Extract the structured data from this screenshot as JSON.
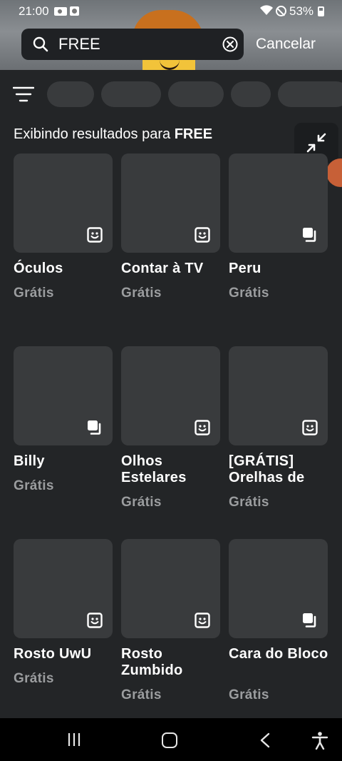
{
  "status": {
    "time": "21:00",
    "battery": "53%"
  },
  "search": {
    "value": "FREE",
    "cancel_label": "Cancelar"
  },
  "results": {
    "prefix": "Exibindo resultados para ",
    "query": "FREE"
  },
  "items": [
    {
      "name": "Óculos",
      "price": "Grátis",
      "type_icon": "face-icon"
    },
    {
      "name": "Contar à TV",
      "price": "Grátis",
      "type_icon": "face-icon"
    },
    {
      "name": "Peru",
      "price": "Grátis",
      "type_icon": "bundle-icon"
    },
    {
      "name": "Billy",
      "price": "Grátis",
      "type_icon": "bundle-icon"
    },
    {
      "name": "Olhos Estelares",
      "price": "Grátis",
      "type_icon": "face-icon"
    },
    {
      "name": "[GRÁTIS] Orelhas de",
      "price": "Grátis",
      "type_icon": "face-icon"
    },
    {
      "name": "Rosto UwU",
      "price": "Grátis",
      "type_icon": "face-icon"
    },
    {
      "name": "Rosto Zumbido",
      "price": "Grátis",
      "type_icon": "face-icon"
    },
    {
      "name": "Cara do Bloco",
      "price": "Grátis",
      "type_icon": "bundle-icon"
    }
  ],
  "colors": {
    "background": "#232527",
    "card": "#393b3d",
    "price_text": "#9b9d9f"
  }
}
